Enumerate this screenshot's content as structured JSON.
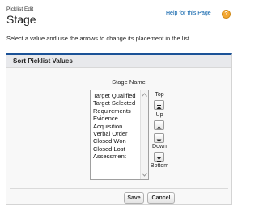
{
  "header": {
    "subtitle": "Picklist Edit",
    "title": "Stage",
    "help_link": "Help for this Page"
  },
  "instructions": "Select a value and use the arrows to change its placement in the list.",
  "section": {
    "title": "Sort Picklist Values",
    "list_label": "Stage Name",
    "options": [
      "Target Qualified",
      "Target Selected",
      "Requirements",
      "Evidence",
      "Acquisition",
      "Verbal Order",
      "Closed Won",
      "Closed Lost",
      "Assessment"
    ]
  },
  "controls": {
    "top": "Top",
    "up": "Up",
    "down": "Down",
    "bottom": "Bottom"
  },
  "buttons": {
    "save": "Save",
    "cancel": "Cancel"
  },
  "colors": {
    "accent": "#1b5297",
    "link": "#015ba7",
    "help_icon": "#f3a731"
  }
}
